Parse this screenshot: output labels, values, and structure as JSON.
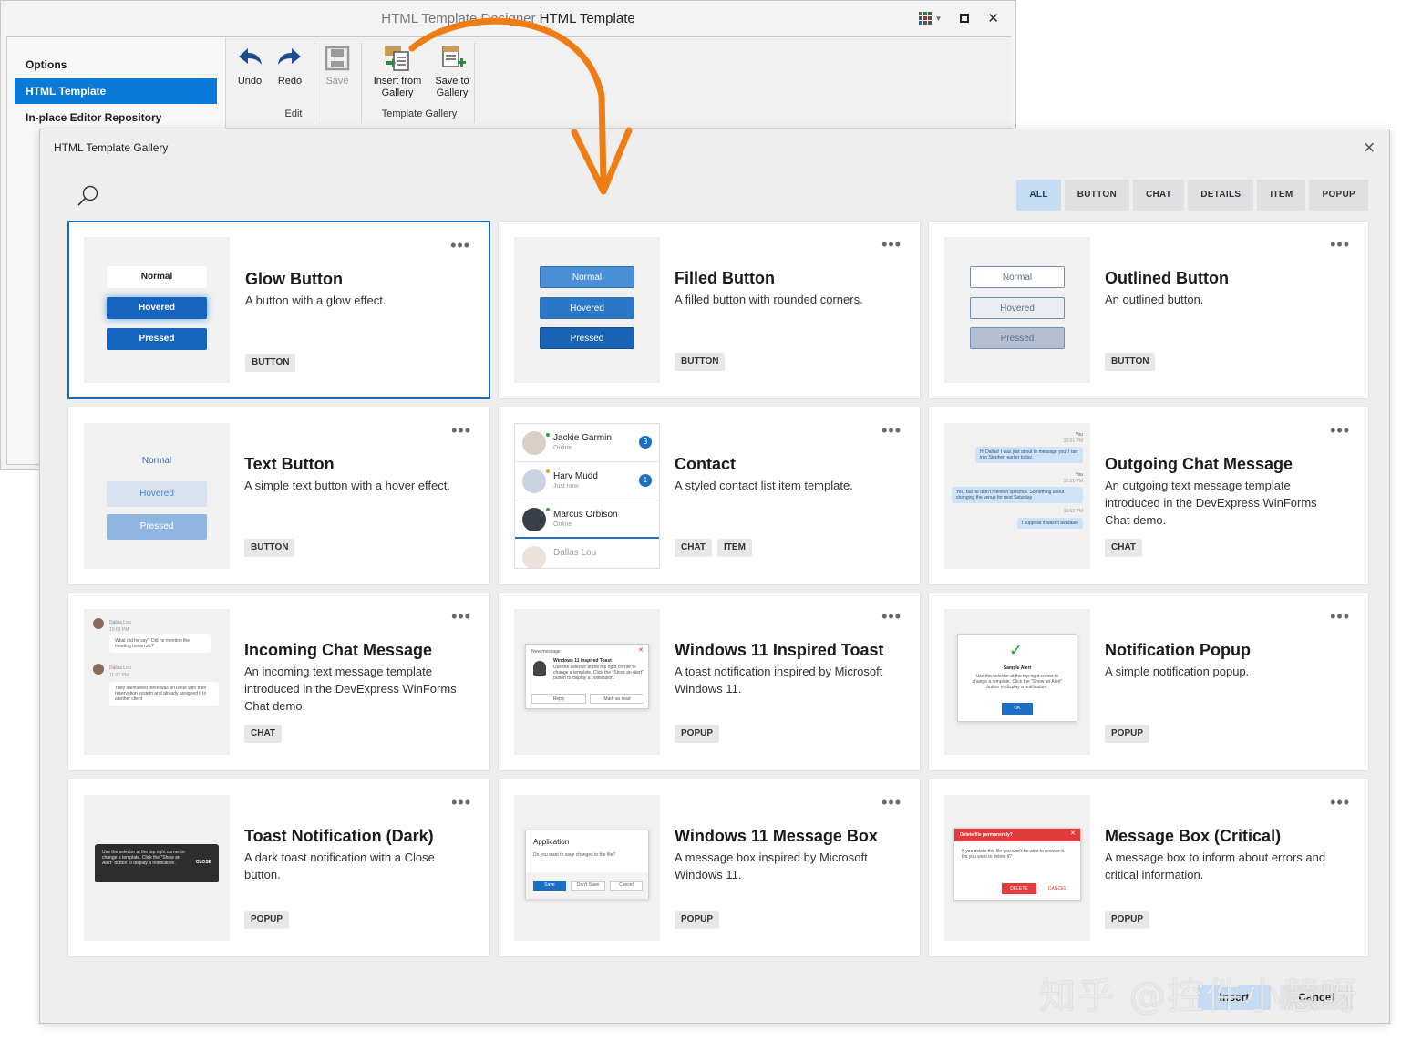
{
  "designer": {
    "title_dim": "HTML Template Designer",
    "title_active": "HTML Template",
    "side_items": [
      "Options",
      "HTML Template",
      "In-place Editor Repository"
    ],
    "ribbon": {
      "undo": "Undo",
      "redo": "Redo",
      "save": "Save",
      "insert_from_gallery": "Insert from Gallery",
      "save_to_gallery": "Save to Gallery",
      "group_edit": "Edit",
      "group_gallery": "Template Gallery"
    }
  },
  "gallery": {
    "title": "HTML Template Gallery",
    "filters": [
      "ALL",
      "BUTTON",
      "CHAT",
      "DETAILS",
      "ITEM",
      "POPUP"
    ],
    "active_filter": "ALL",
    "cards": [
      {
        "title": "Glow Button",
        "desc": "A button with a glow effect.",
        "tags": [
          "BUTTON"
        ]
      },
      {
        "title": "Filled Button",
        "desc": "A filled button with rounded corners.",
        "tags": [
          "BUTTON"
        ]
      },
      {
        "title": "Outlined Button",
        "desc": "An outlined button.",
        "tags": [
          "BUTTON"
        ]
      },
      {
        "title": "Text Button",
        "desc": "A simple text button with a hover effect.",
        "tags": [
          "BUTTON"
        ]
      },
      {
        "title": "Contact",
        "desc": "A styled contact list item template.",
        "tags": [
          "CHAT",
          "ITEM"
        ]
      },
      {
        "title": "Outgoing Chat Message",
        "desc": "An outgoing text message template introduced in the DevExpress WinForms Chat demo.",
        "tags": [
          "CHAT"
        ]
      },
      {
        "title": "Incoming Chat Message",
        "desc": "An incoming text message template introduced in the DevExpress WinForms Chat demo.",
        "tags": [
          "CHAT"
        ]
      },
      {
        "title": "Windows 11 Inspired Toast",
        "desc": "A toast notification inspired by Microsoft Windows 11.",
        "tags": [
          "POPUP"
        ]
      },
      {
        "title": "Notification Popup",
        "desc": "A simple notification popup.",
        "tags": [
          "POPUP"
        ]
      },
      {
        "title": "Toast Notification (Dark)",
        "desc": "A dark toast notification with a Close button.",
        "tags": [
          "POPUP"
        ]
      },
      {
        "title": "Windows 11 Message Box",
        "desc": "A message box inspired by Microsoft Windows 11.",
        "tags": [
          "POPUP"
        ]
      },
      {
        "title": "Message Box (Critical)",
        "desc": "A message box to inform about errors and critical information.",
        "tags": [
          "POPUP"
        ]
      }
    ],
    "more_glyph": "•••",
    "footer": {
      "insert": "Insert",
      "cancel": "Cancel"
    }
  },
  "thumbs": {
    "states": {
      "normal": "Normal",
      "hovered": "Hovered",
      "pressed": "Pressed"
    },
    "contacts": [
      {
        "name": "Jackie Garmin",
        "status": "Online",
        "badge": "3"
      },
      {
        "name": "Harv Mudd",
        "status": "Just now",
        "badge": "1"
      },
      {
        "name": "Marcus Orbison",
        "status": "Online",
        "badge": ""
      },
      {
        "name": "Dallas Lou",
        "status": "",
        "badge": ""
      }
    ],
    "outgoing": {
      "you": "You",
      "t1": "10:01 PM",
      "m1": "Hi Dallas! I was just about to message you! I ran into Stephen earlier today.",
      "t2": "10:51 PM",
      "m2": "Yes, but he didn't mention specifics. Something about changing the venue for next Saturday",
      "t3": "10:53 PM",
      "m3": "I suppose it wasn't available"
    },
    "incoming": {
      "name": "Dallas Lou",
      "t1": "10:08 PM",
      "m1": "What did he say? Did he mention the meeting tomorrow?",
      "t2": "11:07 PM",
      "m2": "They mentioned there was an issue with their reservation system and already assigned it to another client"
    },
    "toast": {
      "header": "New message",
      "title": "Windows 11 Inspired Toast",
      "body": "Use the selector at the top right corner to change a template. Click the \"Show an Alert\" button to display a notification.",
      "reply": "Reply",
      "mark": "Mark as read"
    },
    "notif": {
      "title": "Sample Alert",
      "body": "Use the selector at the top right corner to change a template. Click the \"Show an Alert\" button to display a notification.",
      "ok": "OK"
    },
    "dark": {
      "body": "Use the selector at the top right corner to change a template. Click the \"Show an Alert\" button to display a notification.",
      "close": "CLOSE"
    },
    "msgbox": {
      "title": "Application",
      "body": "Do you want to save changes to the file?",
      "save": "Save",
      "dont": "Don't Save",
      "cancel": "Cancel"
    },
    "critical": {
      "title": "Delete file permanently?",
      "body": "If you delete this file you won't be able to recover it. Do you want to delete it?",
      "del": "DELETE",
      "cancel": "CANCEL"
    }
  },
  "watermark": "知乎 @控件小慧呀",
  "colors": {
    "accent": "#0a7ad8",
    "arrow": "#f07d14",
    "selected_border": "#1a6fb8"
  }
}
